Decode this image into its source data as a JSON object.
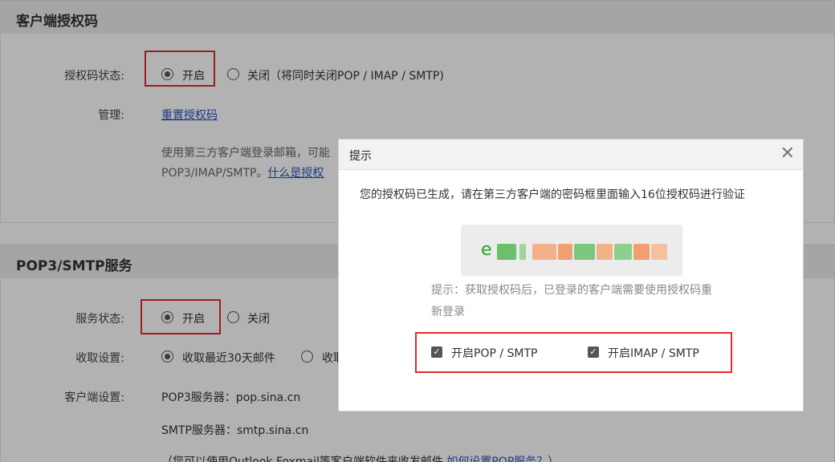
{
  "section1": {
    "title": "客户端授权码",
    "status_label": "授权码状态:",
    "status_on": "开启",
    "status_off": "关闭（将同时关闭POP / IMAP / SMTP)",
    "manage_label": "管理:",
    "reset_link": "重置授权码",
    "desc_line1": "使用第三方客户端登录邮箱，可能",
    "desc_line2_prefix": "POP3/IMAP/SMTP。",
    "desc_line2_link": "什么是授权"
  },
  "section2": {
    "title": "POP3/SMTP服务",
    "status_label": "服务状态:",
    "status_on": "开启",
    "status_off": "关闭",
    "receive_label": "收取设置:",
    "receive_option1": "收取最近30天邮件",
    "receive_option2": "收取",
    "client_label": "客户端设置:",
    "pop3_server": "POP3服务器：pop.sina.cn",
    "smtp_server": "SMTP服务器：smtp.sina.cn",
    "footer_note": "（您可以使用Outlook Foxmail等客户端软件来收发邮件",
    "footer_link": "如何设置POP服务？）"
  },
  "dialog": {
    "title": "提示",
    "close_glyph": "✕",
    "message": "您的授权码已生成，请在第三方客户端的密码框里面输入16位授权码进行验证",
    "code_first_char": "e",
    "tip": "提示：获取授权码后，已登录的客户端需要使用授权码重新登录",
    "checkbox_pop": "开启POP / SMTP",
    "checkbox_imap": "开启IMAP / SMTP"
  },
  "colors": {
    "link": "#2a55b8",
    "highlight_border": "#e02b2b",
    "code_green": "#25a025",
    "code_orange": "#f0a070"
  }
}
